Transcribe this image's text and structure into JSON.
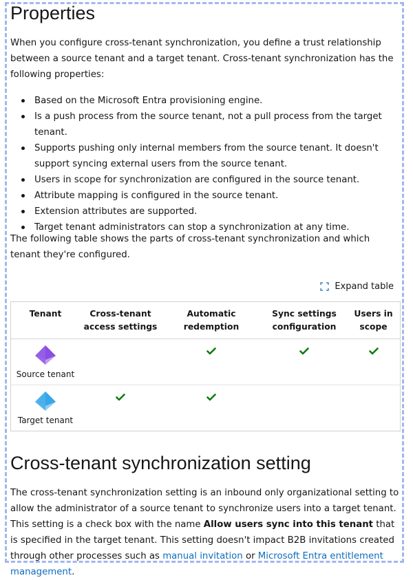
{
  "section1": {
    "heading": "Properties",
    "intro": "When you configure cross-tenant synchronization, you define a trust relationship between a source tenant and a target tenant. Cross-tenant synchronization has the following properties:",
    "bullets": [
      "Based on the Microsoft Entra provisioning engine.",
      "Is a push process from the source tenant, not a pull process from the target tenant.",
      "Supports pushing only internal members from the source tenant. It doesn't support syncing external users from the source tenant.",
      "Users in scope for synchronization are configured in the source tenant.",
      "Attribute mapping is configured in the source tenant.",
      "Extension attributes are supported.",
      "Target tenant administrators can stop a synchronization at any time."
    ],
    "table_intro": "The following table shows the parts of cross-tenant synchronization and which tenant they're configured."
  },
  "expand_table": {
    "label": "Expand table",
    "icon": "expand-icon"
  },
  "table": {
    "headers": [
      "Tenant",
      "Cross-tenant access settings",
      "Automatic redemption",
      "Sync settings configuration",
      "Users in scope"
    ],
    "rows": [
      {
        "tenant": "Source tenant",
        "icon": "source-tenant-icon",
        "icon_color": "#8a4ee3",
        "checks": [
          false,
          true,
          true,
          true
        ]
      },
      {
        "tenant": "Target tenant",
        "icon": "target-tenant-icon",
        "icon_color": "#38a7e8",
        "checks": [
          true,
          true,
          false,
          false
        ]
      }
    ],
    "check_color": "#107c10"
  },
  "section2": {
    "heading": "Cross-tenant synchronization setting",
    "p1": "The cross-tenant synchronization setting is an inbound only organizational setting to allow the administrator of a source tenant to synchronize users into a target tenant. This setting is a check box with the name ",
    "bold": "Allow users sync into this tenant",
    "p2": " that is specified in the target tenant. This setting doesn't impact B2B invitations created through other processes such as ",
    "link1": "manual invitation",
    "or": " or ",
    "link2": "Microsoft Entra entitlement management",
    "end": "."
  }
}
